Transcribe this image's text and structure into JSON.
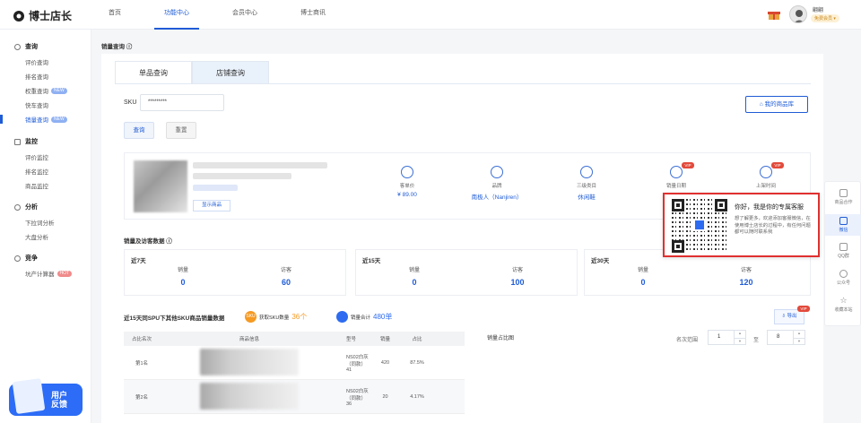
{
  "app": {
    "logo_text": "博士店长"
  },
  "nav": [
    {
      "label": "首页"
    },
    {
      "label": "功能中心"
    },
    {
      "label": "会员中心"
    },
    {
      "label": "博士商讯"
    }
  ],
  "user": {
    "name": "翩翩",
    "badge": "免费会员 ▾"
  },
  "sidebar": {
    "groups": [
      {
        "label": "查询",
        "items": [
          {
            "label": "评价查询",
            "tag": ""
          },
          {
            "label": "排名查询",
            "tag": ""
          },
          {
            "label": "权重查询",
            "tag": "NEW"
          },
          {
            "label": "快车查询",
            "tag": ""
          },
          {
            "label": "销量查询",
            "tag": "NEW"
          }
        ]
      },
      {
        "label": "监控",
        "items": [
          {
            "label": "评价监控",
            "tag": ""
          },
          {
            "label": "排名监控",
            "tag": ""
          },
          {
            "label": "商品监控",
            "tag": ""
          }
        ]
      },
      {
        "label": "分析",
        "items": [
          {
            "label": "下拉词分析",
            "tag": ""
          },
          {
            "label": "大盘分析",
            "tag": ""
          }
        ]
      },
      {
        "label": "竞争",
        "items": [
          {
            "label": "坑产计算器",
            "tag": "HOT"
          }
        ]
      }
    ],
    "feedback_label_1": "用户",
    "feedback_label_2": "反馈"
  },
  "page": {
    "breadcrumb": "销量查询 ⓘ",
    "tabs": [
      {
        "label": "单品查询"
      },
      {
        "label": "店铺查询"
      }
    ],
    "sku_label": "SKU",
    "sku_value": "*********",
    "query_button": "查询",
    "reset_button": "重置",
    "my_store_button": "我的商品库",
    "product_button": "显示商品",
    "stats": [
      {
        "label": "客单价",
        "value": "¥ 89.00",
        "vip": false
      },
      {
        "label": "品牌",
        "value": "南极人（Nanjiren）",
        "vip": false
      },
      {
        "label": "三级类目",
        "value": "休闲鞋",
        "vip": false
      },
      {
        "label": "销量日期",
        "value": "",
        "vip": true
      },
      {
        "label": "上架时间",
        "value": "",
        "vip": true
      }
    ],
    "vip_tag": "VIP",
    "sales_title": "销量及访客数据 ⓘ",
    "periods": [
      {
        "title": "近7天",
        "sales_label": "销量",
        "visits_label": "访客",
        "sales": "0",
        "visits": "60"
      },
      {
        "title": "近15天",
        "sales_label": "销量",
        "visits_label": "访客",
        "sales": "0",
        "visits": "100"
      },
      {
        "title": "近30天",
        "sales_label": "销量",
        "visits_label": "访客",
        "sales": "0",
        "visits": "120"
      }
    ],
    "spu_title": "近15天同SPU下其他SKU商品销量数据",
    "kpi1_icon": "SKU",
    "kpi1_label": "获取SKU数量",
    "kpi1_value": "36个",
    "kpi2_label": "销量合计",
    "kpi2_value": "480单",
    "export_button": "⇩ 导出",
    "table": {
      "headers": [
        "占比名次",
        "商品信息",
        "型号",
        "销量",
        "占比"
      ],
      "rows": [
        {
          "rank": "第1名",
          "model": "NS02白灰（同款）41",
          "sales": "420",
          "ratio": "87.5%"
        },
        {
          "rank": "第2名",
          "model": "NS02白灰（同款）36",
          "sales": "20",
          "ratio": "4.17%"
        }
      ]
    },
    "chart_title": "销量占比图",
    "range_label": "名次范围",
    "range_from": "1",
    "range_to_label": "至",
    "range_to": "8"
  },
  "right_tools": [
    {
      "label": "商品合作"
    },
    {
      "label": "微信"
    },
    {
      "label": "QQ群"
    },
    {
      "label": "公众号"
    },
    {
      "label": "收藏本站"
    }
  ],
  "popup": {
    "title": "你好，我是你的专属客服",
    "body": "想了解更多，欢迎添加客服微信，在使用博士店长的过程中，有任何问题都可以随时联系我"
  },
  "colors": {
    "accent": "#1f5cd6",
    "highlight": "#e03030",
    "kpi_orange": "#f59a23",
    "vip_red": "#e24a3b"
  }
}
